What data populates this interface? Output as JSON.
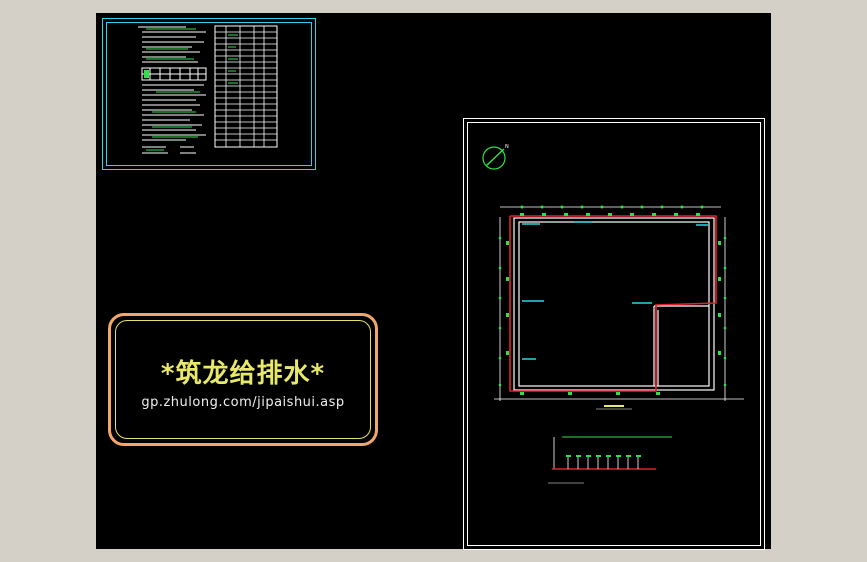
{
  "watermark": {
    "title": "*筑龙给排水*",
    "url": "gp.zhulong.com/jipaishui.asp"
  },
  "colors": {
    "background": "#000000",
    "frame": "#ffffff",
    "sheet_border": "#2ad4e6",
    "watermark_border": "#f2a66a",
    "watermark_text": "#e8e86a",
    "pipe_red": "#e0202a",
    "accent_green": "#2ee04a",
    "accent_cyan": "#2ad4e6"
  },
  "icons": {
    "north_arrow": "north-arrow-icon"
  }
}
